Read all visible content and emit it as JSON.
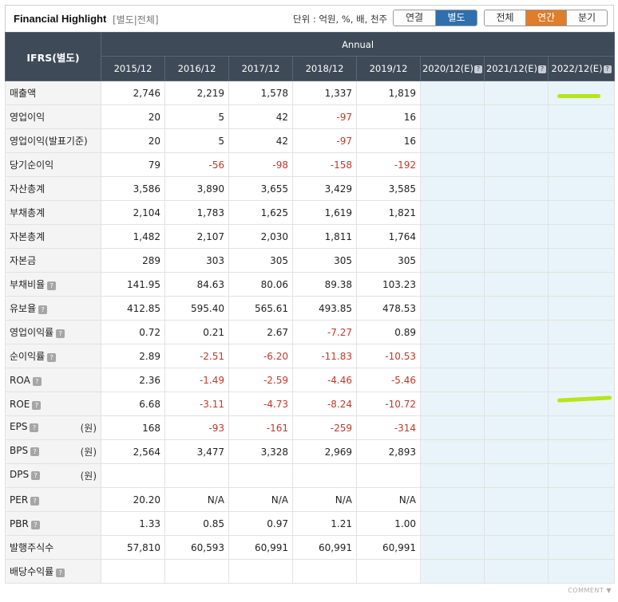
{
  "header": {
    "title": "Financial Highlight",
    "subtitle": "[별도|전체]",
    "unit": "단위 : 억원, %, 배, 천주",
    "toggle_basis": [
      {
        "label": "연결",
        "active": false
      },
      {
        "label": "별도",
        "active": true
      }
    ],
    "toggle_period": [
      {
        "label": "전체",
        "active": false
      },
      {
        "label": "연간",
        "active": true
      },
      {
        "label": "분기",
        "active": false
      }
    ]
  },
  "table": {
    "corner_label": "IFRS(별도)",
    "group_label": "Annual",
    "columns": [
      "2015/12",
      "2016/12",
      "2017/12",
      "2018/12",
      "2019/12",
      "2020/12(E)",
      "2021/12(E)",
      "2022/12(E)"
    ],
    "estimate_columns": [
      5,
      6,
      7
    ],
    "rows": [
      {
        "label": "매출액",
        "help": false,
        "unit": "",
        "values": [
          "2,746",
          "2,219",
          "1,578",
          "1,337",
          "1,819",
          "",
          "",
          ""
        ]
      },
      {
        "label": "영업이익",
        "help": false,
        "unit": "",
        "values": [
          "20",
          "5",
          "42",
          "-97",
          "16",
          "",
          "",
          ""
        ]
      },
      {
        "label": "영업이익(발표기준)",
        "help": false,
        "unit": "",
        "values": [
          "20",
          "5",
          "42",
          "-97",
          "16",
          "",
          "",
          ""
        ]
      },
      {
        "label": "당기순이익",
        "help": false,
        "unit": "",
        "values": [
          "79",
          "-56",
          "-98",
          "-158",
          "-192",
          "",
          "",
          ""
        ]
      },
      {
        "label": "자산총계",
        "help": false,
        "unit": "",
        "values": [
          "3,586",
          "3,890",
          "3,655",
          "3,429",
          "3,585",
          "",
          "",
          ""
        ]
      },
      {
        "label": "부채총계",
        "help": false,
        "unit": "",
        "values": [
          "2,104",
          "1,783",
          "1,625",
          "1,619",
          "1,821",
          "",
          "",
          ""
        ]
      },
      {
        "label": "자본총계",
        "help": false,
        "unit": "",
        "values": [
          "1,482",
          "2,107",
          "2,030",
          "1,811",
          "1,764",
          "",
          "",
          ""
        ]
      },
      {
        "label": "자본금",
        "help": false,
        "unit": "",
        "values": [
          "289",
          "303",
          "305",
          "305",
          "305",
          "",
          "",
          ""
        ]
      },
      {
        "label": "부채비율",
        "help": true,
        "unit": "",
        "values": [
          "141.95",
          "84.63",
          "80.06",
          "89.38",
          "103.23",
          "",
          "",
          ""
        ]
      },
      {
        "label": "유보율",
        "help": true,
        "unit": "",
        "values": [
          "412.85",
          "595.40",
          "565.61",
          "493.85",
          "478.53",
          "",
          "",
          ""
        ]
      },
      {
        "label": "영업이익률",
        "help": true,
        "unit": "",
        "values": [
          "0.72",
          "0.21",
          "2.67",
          "-7.27",
          "0.89",
          "",
          "",
          ""
        ]
      },
      {
        "label": "순이익률",
        "help": true,
        "unit": "",
        "values": [
          "2.89",
          "-2.51",
          "-6.20",
          "-11.83",
          "-10.53",
          "",
          "",
          ""
        ]
      },
      {
        "label": "ROA",
        "help": true,
        "unit": "",
        "values": [
          "2.36",
          "-1.49",
          "-2.59",
          "-4.46",
          "-5.46",
          "",
          "",
          ""
        ]
      },
      {
        "label": "ROE",
        "help": true,
        "unit": "",
        "values": [
          "6.68",
          "-3.11",
          "-4.73",
          "-8.24",
          "-10.72",
          "",
          "",
          ""
        ]
      },
      {
        "label": "EPS",
        "help": true,
        "unit": "(원)",
        "values": [
          "168",
          "-93",
          "-161",
          "-259",
          "-314",
          "",
          "",
          ""
        ]
      },
      {
        "label": "BPS",
        "help": true,
        "unit": "(원)",
        "values": [
          "2,564",
          "3,477",
          "3,328",
          "2,969",
          "2,893",
          "",
          "",
          ""
        ]
      },
      {
        "label": "DPS",
        "help": true,
        "unit": "(원)",
        "values": [
          "",
          "",
          "",
          "",
          "",
          "",
          "",
          ""
        ]
      },
      {
        "label": "PER",
        "help": true,
        "unit": "",
        "values": [
          "20.20",
          "N/A",
          "N/A",
          "N/A",
          "N/A",
          "",
          "",
          ""
        ]
      },
      {
        "label": "PBR",
        "help": true,
        "unit": "",
        "values": [
          "1.33",
          "0.85",
          "0.97",
          "1.21",
          "1.00",
          "",
          "",
          ""
        ]
      },
      {
        "label": "발행주식수",
        "help": false,
        "unit": "",
        "values": [
          "57,810",
          "60,593",
          "60,991",
          "60,991",
          "60,991",
          "",
          "",
          ""
        ]
      },
      {
        "label": "배당수익률",
        "help": true,
        "unit": "",
        "values": [
          "",
          "",
          "",
          "",
          "",
          "",
          "",
          ""
        ]
      }
    ]
  },
  "footer": {
    "comment_label": "COMMENT ▼"
  },
  "colors": {
    "header_bg": "#3e4a58",
    "estimate_bg": "#e8f4fa",
    "negative": "#c0392b",
    "active_basis": "#2f6fae",
    "active_period": "#e07d2a",
    "highlight_mark": "#b6e51a"
  }
}
